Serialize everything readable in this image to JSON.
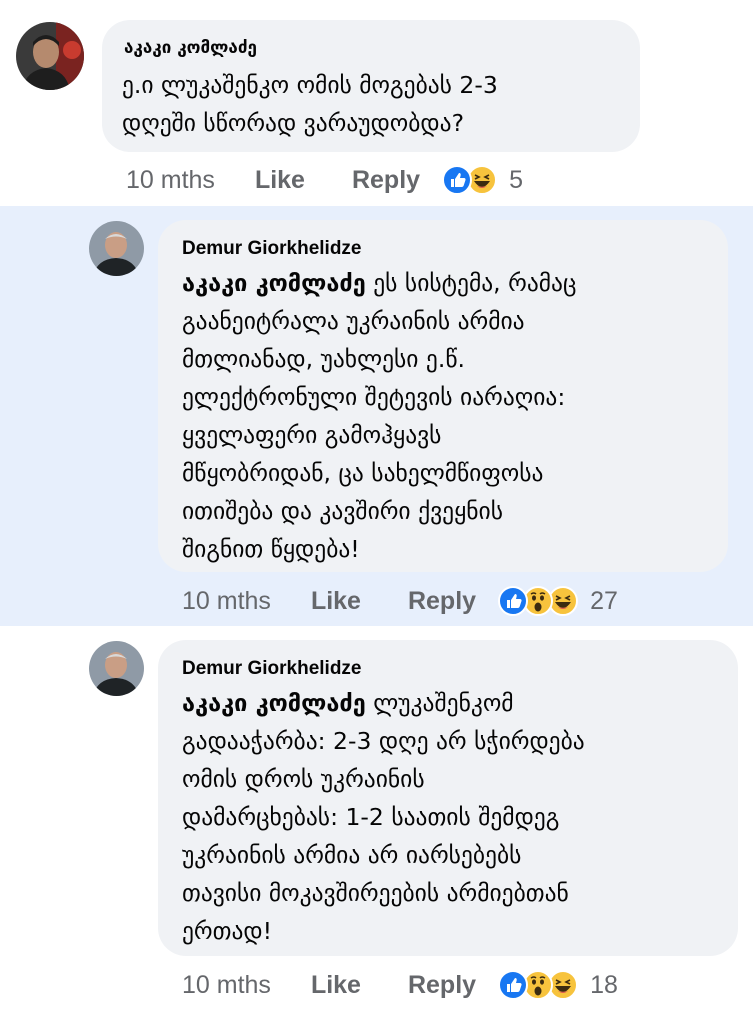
{
  "comments": [
    {
      "author": "აკაკი კომლაძე",
      "mention": "",
      "text": "ე.ი ლუკაშენკო ომის მოგებას 2-3\nდღეში სწორად ვარაუდობდა?",
      "time": "10 mths",
      "like_label": "Like",
      "reply_label": "Reply",
      "reaction_icons": [
        "like-icon",
        "haha-icon"
      ],
      "reaction_count": "5"
    },
    {
      "author": "Demur Giorkhelidze",
      "mention": "აკაკი კომლაძე",
      "text": " ეს სისტემა, რამაც\nგაანეიტრალა უკრაინის არმია\nმთლიანად, უახლესი ე.წ.\nელექტრონული შეტევის იარაღია:\nყველაფერი გამოჰყავს\nმწყობრიდან, ცა სახელმწიფოსა\nითიშება და კავშირი ქვეყნის\nშიგნით წყდება!",
      "time": "10 mths",
      "like_label": "Like",
      "reply_label": "Reply",
      "reaction_icons": [
        "like-icon",
        "wow-icon",
        "haha-icon"
      ],
      "reaction_count": "27"
    },
    {
      "author": "Demur Giorkhelidze",
      "mention": "აკაკი კომლაძე",
      "text": " ლუკაშენკომ\nგადააჭარბა: 2-3 დღე არ სჭირდება\nომის დროს უკრაინის\nდამარცხებას: 1-2 საათის შემდეგ\nუკრაინის არმია არ იარსებებს\nთავისი მოკავშირეების არმიებთან\nერთად!",
      "time": "10 mths",
      "like_label": "Like",
      "reply_label": "Reply",
      "reaction_icons": [
        "like-icon",
        "wow-icon",
        "haha-icon"
      ],
      "reaction_count": "18"
    }
  ],
  "colors": {
    "bubble": "#f0f2f5",
    "highlight": "#e7effc",
    "meta_text": "#65676b",
    "like_blue": "#1877f2",
    "emoji_yellow": "#f7c33d"
  }
}
